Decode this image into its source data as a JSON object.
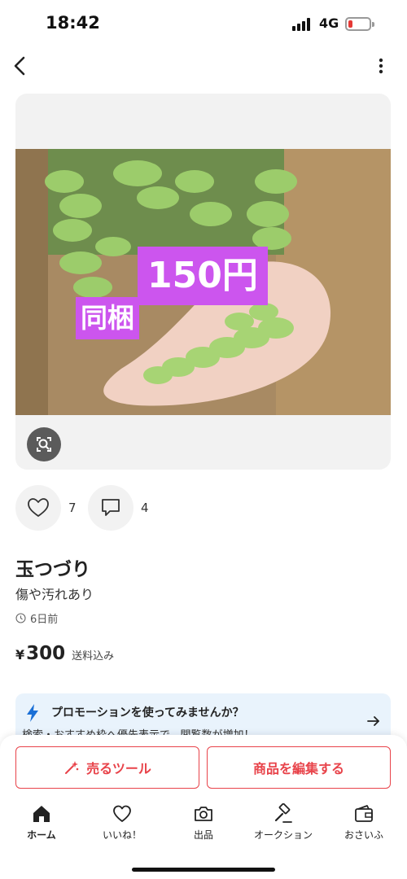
{
  "status_bar": {
    "time": "18:42",
    "network": "4G",
    "battery_color": "#e53935",
    "icons": [
      "signal-icon",
      "battery-icon"
    ]
  },
  "nav": {
    "back_icon": "chevron-left-icon",
    "more_icon": "more-vertical-icon"
  },
  "product_image": {
    "overlay_price": "150円",
    "overlay_bundle": "同梱",
    "overlay_color": "#cc55ee",
    "lens_icon": "image-search-icon"
  },
  "engagement": {
    "likes": "7",
    "comments": "4"
  },
  "item": {
    "title": "玉つづり",
    "condition": "傷や汚れあり",
    "posted": "6日前",
    "price_currency": "¥",
    "price": "300",
    "shipping": "送料込み"
  },
  "promo": {
    "title": "プロモーションを使ってみませんか？",
    "text": "検索・おすすめ枠へ優先表示で、閲覧数が増加！",
    "accent_color": "#1a6fd6"
  },
  "actions": {
    "sell_tools": "売るツール",
    "edit_item": "商品を編集する",
    "accent_color": "#e8434a"
  },
  "tab_bar": {
    "tabs": [
      {
        "label": "ホーム",
        "icon": "home-icon"
      },
      {
        "label": "いいね！",
        "icon": "heart-icon"
      },
      {
        "label": "出品",
        "icon": "camera-icon"
      },
      {
        "label": "オークション",
        "icon": "gavel-icon"
      },
      {
        "label": "おさいふ",
        "icon": "wallet-icon"
      }
    ]
  }
}
